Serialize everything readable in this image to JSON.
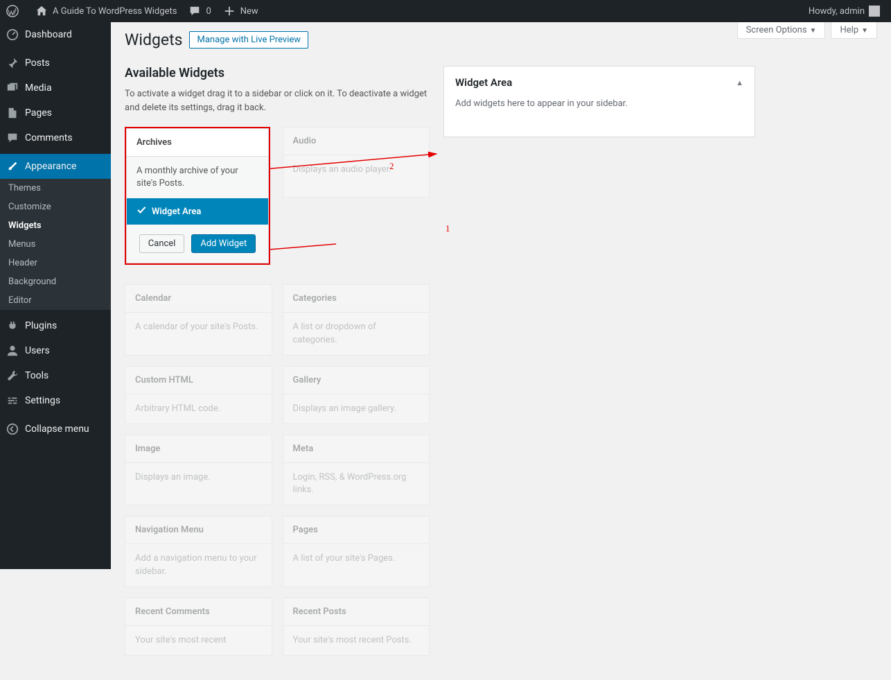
{
  "adminbar": {
    "site_name": "A Guide To WordPress Widgets",
    "comments_count": "0",
    "new_label": "New",
    "howdy": "Howdy, admin"
  },
  "sidebar": {
    "items": [
      {
        "label": "Dashboard",
        "icon": "dashboard"
      },
      {
        "label": "Posts",
        "icon": "pin"
      },
      {
        "label": "Media",
        "icon": "media"
      },
      {
        "label": "Pages",
        "icon": "pages"
      },
      {
        "label": "Comments",
        "icon": "comments"
      },
      {
        "label": "Appearance",
        "icon": "brush",
        "current": true
      },
      {
        "label": "Plugins",
        "icon": "plug"
      },
      {
        "label": "Users",
        "icon": "user"
      },
      {
        "label": "Tools",
        "icon": "wrench"
      },
      {
        "label": "Settings",
        "icon": "sliders"
      },
      {
        "label": "Collapse menu",
        "icon": "collapse"
      }
    ],
    "submenu": [
      "Themes",
      "Customize",
      "Widgets",
      "Menus",
      "Header",
      "Background",
      "Editor"
    ],
    "submenu_current": "Widgets"
  },
  "top_actions": {
    "screen_options": "Screen Options",
    "help": "Help"
  },
  "page": {
    "title": "Widgets",
    "live_preview": "Manage with Live Preview"
  },
  "available": {
    "title": "Available Widgets",
    "desc": "To activate a widget drag it to a sidebar or click on it. To deactivate a widget and delete its settings, drag it back."
  },
  "archive_panel": {
    "title": "Archives",
    "desc": "A monthly archive of your site's Posts.",
    "area_label": "Widget Area",
    "cancel": "Cancel",
    "add": "Add Widget"
  },
  "widgets": [
    {
      "title": "Archives",
      "desc": "A monthly archive of your site's Posts."
    },
    {
      "title": "Audio",
      "desc": "Displays an audio player."
    },
    {
      "title": "Calendar",
      "desc": "A calendar of your site's Posts."
    },
    {
      "title": "Categories",
      "desc": "A list or dropdown of categories."
    },
    {
      "title": "Custom HTML",
      "desc": "Arbitrary HTML code."
    },
    {
      "title": "Gallery",
      "desc": "Displays an image gallery."
    },
    {
      "title": "Image",
      "desc": "Displays an image."
    },
    {
      "title": "Meta",
      "desc": "Login, RSS, & WordPress.org links."
    },
    {
      "title": "Navigation Menu",
      "desc": "Add a navigation menu to your sidebar."
    },
    {
      "title": "Pages",
      "desc": "A list of your site's Pages."
    },
    {
      "title": "Recent Comments",
      "desc": "Your site's most recent"
    },
    {
      "title": "Recent Posts",
      "desc": "Your site's most recent Posts."
    }
  ],
  "area": {
    "title": "Widget Area",
    "desc": "Add widgets here to appear in your sidebar."
  },
  "annotations": {
    "one": "1",
    "two": "2"
  }
}
